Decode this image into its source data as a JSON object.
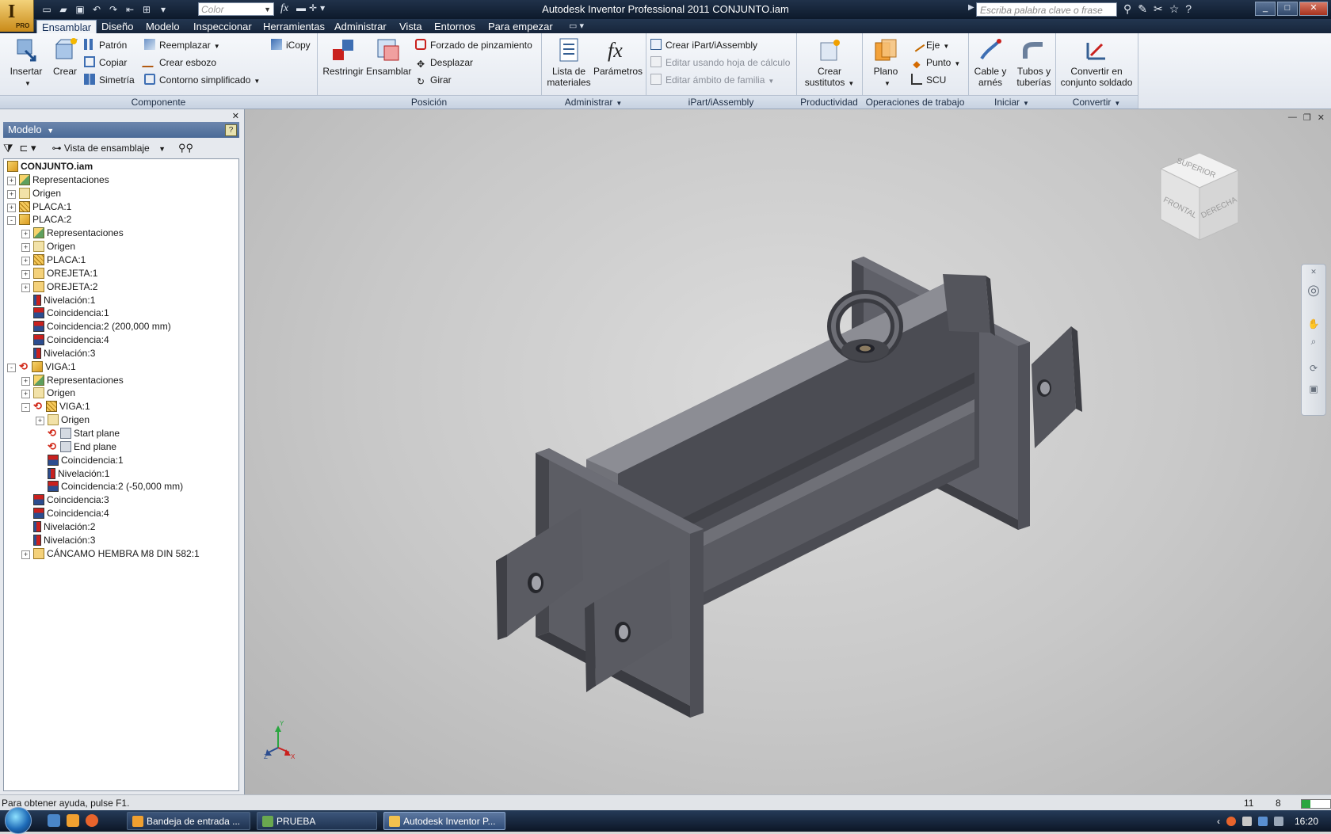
{
  "app": {
    "window_title": "Autodesk Inventor Professional 2011    CONJUNTO.iam",
    "logo_letter": "I",
    "logo_sub": "PRO"
  },
  "quick_access": {
    "color_combo": "Color",
    "help_search_placeholder": "Escriba palabra clave o frase"
  },
  "ribbon_tabs": [
    "Ensamblar",
    "Diseño",
    "Modelo",
    "Inspeccionar",
    "Herramientas",
    "Administrar",
    "Vista",
    "Entornos",
    "Para empezar"
  ],
  "ribbon": {
    "componente": {
      "title": "Componente",
      "insertar": "Insertar",
      "crear": "Crear",
      "patron": "Patrón",
      "copiar": "Copiar",
      "simetria": "Simetría",
      "reemplazar": "Reemplazar",
      "crear_esbozo": "Crear esbozo",
      "contorno": "Contorno simplificado",
      "icopy": "iCopy"
    },
    "posicion": {
      "title": "Posición",
      "restringir": "Restringir",
      "ensamblar": "Ensamblar",
      "forzado": "Forzado de pinzamiento",
      "desplazar": "Desplazar",
      "girar": "Girar"
    },
    "administrar": {
      "title": "Administrar",
      "lista1": "Lista de",
      "lista2": "materiales",
      "parametros": "Parámetros"
    },
    "ipart": {
      "title": "iPart/iAssembly",
      "crear": "Crear iPart/iAssembly",
      "editar_hoja": "Editar usando hoja de cálculo",
      "editar_ambito": "Editar ámbito de familia"
    },
    "productividad": {
      "title": "Productividad",
      "l1": "Crear",
      "l2": "sustitutos"
    },
    "operaciones": {
      "title": "Operaciones de trabajo",
      "plano": "Plano",
      "eje": "Eje",
      "punto": "Punto",
      "scu": "SCU"
    },
    "iniciar": {
      "title": "Iniciar",
      "cable1": "Cable y",
      "cable2": "arnés",
      "tubos1": "Tubos y",
      "tubos2": "tuberías"
    },
    "convertir": {
      "title": "Convertir",
      "l1": "Convertir en",
      "l2": "conjunto soldado"
    }
  },
  "browser": {
    "title": "Modelo",
    "view_combo": "Vista de ensamblaje",
    "tree": [
      {
        "label": "CONJUNTO.iam",
        "level": 0,
        "icon": "asm",
        "exp": "",
        "root": true
      },
      {
        "label": "Representaciones",
        "level": 0,
        "icon": "rep",
        "exp": "+"
      },
      {
        "label": "Origen",
        "level": 0,
        "icon": "folder",
        "exp": "+"
      },
      {
        "label": "PLACA:1",
        "level": 0,
        "icon": "part",
        "exp": "+"
      },
      {
        "label": "PLACA:2",
        "level": 0,
        "icon": "asm",
        "exp": "-"
      },
      {
        "label": "Representaciones",
        "level": 1,
        "icon": "rep",
        "exp": "+"
      },
      {
        "label": "Origen",
        "level": 1,
        "icon": "folder",
        "exp": "+"
      },
      {
        "label": "PLACA:1",
        "level": 1,
        "icon": "part",
        "exp": "+"
      },
      {
        "label": "OREJETA:1",
        "level": 1,
        "icon": "part2",
        "exp": "+"
      },
      {
        "label": "OREJETA:2",
        "level": 1,
        "icon": "part2",
        "exp": "+"
      },
      {
        "label": "Nivelación:1",
        "level": 1,
        "icon": "flush",
        "exp": ""
      },
      {
        "label": "Coincidencia:1",
        "level": 1,
        "icon": "mate",
        "exp": ""
      },
      {
        "label": "Coincidencia:2 (200,000 mm)",
        "level": 1,
        "icon": "mate",
        "exp": ""
      },
      {
        "label": "Coincidencia:4",
        "level": 1,
        "icon": "mate",
        "exp": ""
      },
      {
        "label": "Nivelación:3",
        "level": 1,
        "icon": "flush",
        "exp": ""
      },
      {
        "label": "VIGA:1",
        "level": 0,
        "icon": "asm",
        "exp": "-",
        "sync": true
      },
      {
        "label": "Representaciones",
        "level": 1,
        "icon": "rep",
        "exp": "+"
      },
      {
        "label": "Origen",
        "level": 1,
        "icon": "folder",
        "exp": "+"
      },
      {
        "label": "VIGA:1",
        "level": 1,
        "icon": "part",
        "exp": "-",
        "sync": true
      },
      {
        "label": "Origen",
        "level": 2,
        "icon": "folder",
        "exp": "+"
      },
      {
        "label": "Start plane",
        "level": 2,
        "icon": "plane",
        "exp": "",
        "sync": true
      },
      {
        "label": "End plane",
        "level": 2,
        "icon": "plane",
        "exp": "",
        "sync": true
      },
      {
        "label": "Coincidencia:1",
        "level": 2,
        "icon": "mate",
        "exp": ""
      },
      {
        "label": "Nivelación:1",
        "level": 2,
        "icon": "flush",
        "exp": ""
      },
      {
        "label": "Coincidencia:2 (-50,000 mm)",
        "level": 2,
        "icon": "mate",
        "exp": ""
      },
      {
        "label": "Coincidencia:3",
        "level": 1,
        "icon": "mate",
        "exp": ""
      },
      {
        "label": "Coincidencia:4",
        "level": 1,
        "icon": "mate",
        "exp": ""
      },
      {
        "label": "Nivelación:2",
        "level": 1,
        "icon": "flush",
        "exp": ""
      },
      {
        "label": "Nivelación:3",
        "level": 1,
        "icon": "flush",
        "exp": ""
      },
      {
        "label": "CÁNCAMO HEMBRA M8 DIN 582:1",
        "level": 1,
        "icon": "part2",
        "exp": "+"
      }
    ]
  },
  "viewcube": {
    "top": "SUPERIOR",
    "front": "FRONTAL",
    "right": "DERECHA"
  },
  "triad": {
    "x": "X",
    "y": "Y",
    "z": "Z"
  },
  "status": {
    "help": "Para obtener ayuda, pulse F1.",
    "n1": "11",
    "n2": "8"
  },
  "taskbar": {
    "tasks": [
      "Bandeja de entrada ...",
      "PRUEBA",
      "Autodesk Inventor P..."
    ],
    "clock": "16:20"
  }
}
